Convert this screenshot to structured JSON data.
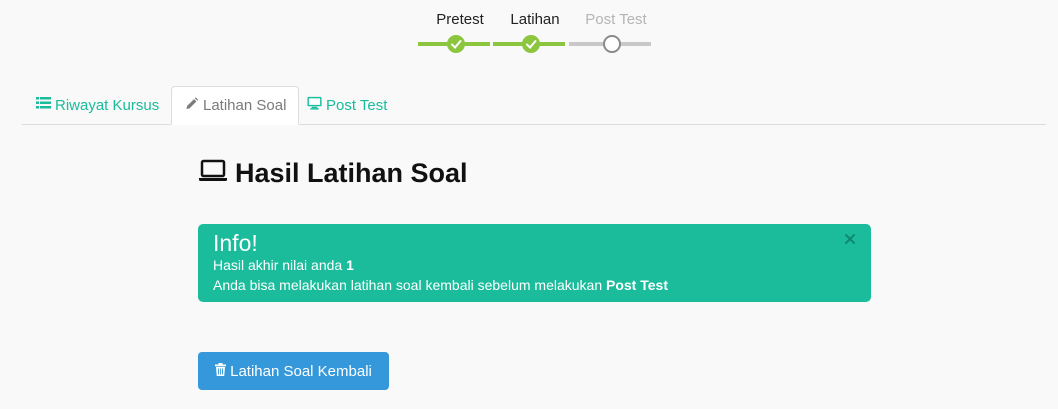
{
  "stepper": {
    "steps": [
      {
        "label": "Pretest",
        "status": "done"
      },
      {
        "label": "Latihan",
        "status": "done"
      },
      {
        "label": "Post Test",
        "status": "pending"
      }
    ],
    "colors": {
      "done": "#8cc63f",
      "pending": "#c8c8c8",
      "done_label": "#222222",
      "pending_label": "#b5b5b5"
    }
  },
  "tabs": [
    {
      "label": "Riwayat Kursus",
      "icon": "list-icon",
      "active": false
    },
    {
      "label": "Latihan Soal",
      "icon": "pencil-icon",
      "active": true
    },
    {
      "label": "Post Test",
      "icon": "monitor-icon",
      "active": false
    }
  ],
  "heading": {
    "icon": "laptop-icon",
    "text": "Hasil Latihan Soal"
  },
  "alert": {
    "title": "Info!",
    "line1_prefix": "Hasil akhir nilai anda ",
    "line1_value": "1",
    "line2_prefix": "Anda bisa melakukan latihan soal kembali sebelum melakukan ",
    "line2_bold": "Post Test",
    "close_icon": "close-icon",
    "color": "#1abc9c"
  },
  "retry_button": {
    "icon": "trash-icon",
    "label": "Latihan Soal Kembali",
    "color": "#3498db"
  },
  "accent_color": "#1abc9c"
}
